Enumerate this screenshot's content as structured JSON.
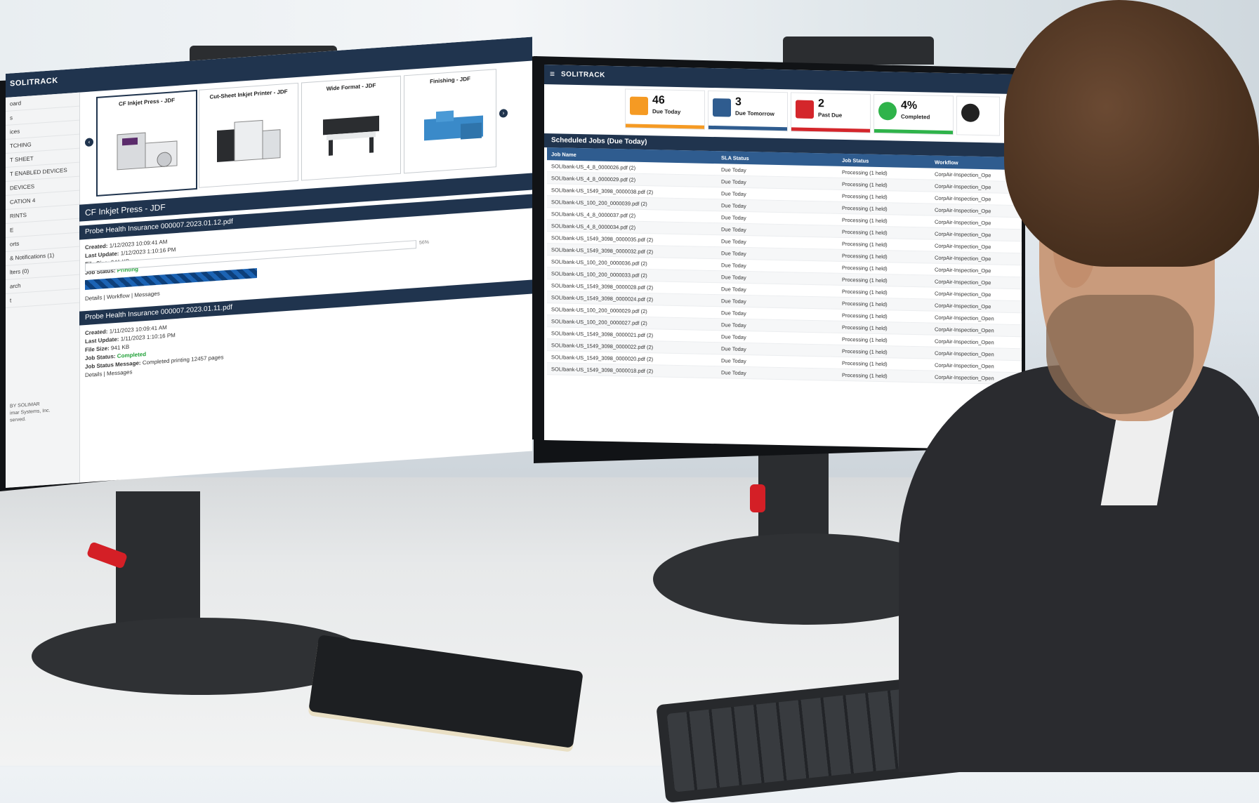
{
  "left_app": {
    "logo": "SOLITRACK",
    "sidebar": [
      "oard",
      "s",
      "ices",
      "TCHING",
      "T SHEET",
      "T ENABLED DEVICES",
      "DEVICES",
      "CATION 4",
      "RINTS",
      "E",
      "orts",
      "& Notifications (1)",
      "lters (0)",
      "arch",
      "t"
    ],
    "sidebar_footer": [
      "BY SOLIMAR",
      "imar Systems, Inc.",
      "served."
    ],
    "carousel": {
      "cards": [
        {
          "title": "CF Inkjet Press - JDF"
        },
        {
          "title": "Cut-Sheet Inkjet Printer - JDF"
        },
        {
          "title": "Wide Format - JDF"
        },
        {
          "title": "Finishing - JDF"
        }
      ]
    },
    "device_section_title": "CF Inkjet Press - JDF",
    "jobs": [
      {
        "title": "Probe Health Insurance 000007.2023.01.12.pdf",
        "created_label": "Created:",
        "created": "1/12/2023 10:09:41 AM",
        "updated_label": "Last Update:",
        "updated": "1/12/2023 1:10:16 PM",
        "size_label": "File Size:",
        "size": "941 KB",
        "status_label": "Job Status:",
        "status": "Printing",
        "progress_pct_text": "56%",
        "progress": 0.56,
        "links": "Details | Workflow | Messages"
      },
      {
        "title": "Probe Health Insurance 000007.2023.01.11.pdf",
        "created_label": "Created:",
        "created": "1/11/2023 10:09:41 AM",
        "updated_label": "Last Update:",
        "updated": "1/11/2023 1:10:16 PM",
        "size_label": "File Size:",
        "size": "941 KB",
        "status_label": "Job Status:",
        "status": "Completed",
        "messages_label": "Job Status Message:",
        "messages": "Completed printing 12457 pages",
        "links": "Details | Messages"
      }
    ]
  },
  "right_app": {
    "logo": "SOLITRACK",
    "tiles": [
      {
        "value": "46",
        "label": "Due Today",
        "color": "#f59a23"
      },
      {
        "value": "3",
        "label": "Due Tomorrow",
        "color": "#2f5c8f"
      },
      {
        "value": "2",
        "label": "Past Due",
        "color": "#d4262b"
      },
      {
        "value": "4%",
        "label": "Completed",
        "color": "#2fb34a"
      }
    ],
    "scheduled_title": "Scheduled Jobs (Due Today)",
    "table_headers": [
      "Job Name",
      "SLA Status",
      "Job Status",
      "Workflow"
    ],
    "rows": [
      [
        "SOLIbank-US_4_8_0000026.pdf (2)",
        "Due Today",
        "Processing (1 held)",
        "CorpAir-Inspection_Ope"
      ],
      [
        "SOLIbank-US_4_8_0000029.pdf (2)",
        "Due Today",
        "Processing (1 held)",
        "CorpAir-Inspection_Ope"
      ],
      [
        "SOLIbank-US_1549_3098_0000038.pdf (2)",
        "Due Today",
        "Processing (1 held)",
        "CorpAir-Inspection_Ope"
      ],
      [
        "SOLIbank-US_100_200_0000039.pdf (2)",
        "Due Today",
        "Processing (1 held)",
        "CorpAir-Inspection_Ope"
      ],
      [
        "SOLIbank-US_4_8_0000037.pdf (2)",
        "Due Today",
        "Processing (1 held)",
        "CorpAir-Inspection_Ope"
      ],
      [
        "SOLIbank-US_4_8_0000034.pdf (2)",
        "Due Today",
        "Processing (1 held)",
        "CorpAir-Inspection_Ope"
      ],
      [
        "SOLIbank-US_1549_3098_0000035.pdf (2)",
        "Due Today",
        "Processing (1 held)",
        "CorpAir-Inspection_Ope"
      ],
      [
        "SOLIbank-US_1549_3098_0000032.pdf (2)",
        "Due Today",
        "Processing (1 held)",
        "CorpAir-Inspection_Ope"
      ],
      [
        "SOLIbank-US_100_200_0000036.pdf (2)",
        "Due Today",
        "Processing (1 held)",
        "CorpAir-Inspection_Ope"
      ],
      [
        "SOLIbank-US_100_200_0000033.pdf (2)",
        "Due Today",
        "Processing (1 held)",
        "CorpAir-Inspection_Ope"
      ],
      [
        "SOLIbank-US_1549_3098_0000028.pdf (2)",
        "Due Today",
        "Processing (1 held)",
        "CorpAir-Inspection_Ope"
      ],
      [
        "SOLIbank-US_1549_3098_0000024.pdf (2)",
        "Due Today",
        "Processing (1 held)",
        "CorpAir-Inspection_Ope"
      ],
      [
        "SOLIbank-US_100_200_0000029.pdf (2)",
        "Due Today",
        "Processing (1 held)",
        "CorpAir-Inspection_Open"
      ],
      [
        "SOLIbank-US_100_200_0000027.pdf (2)",
        "Due Today",
        "Processing (1 held)",
        "CorpAir-Inspection_Open"
      ],
      [
        "SOLIbank-US_1549_3098_0000021.pdf (2)",
        "Due Today",
        "Processing (1 held)",
        "CorpAir-Inspection_Open"
      ],
      [
        "SOLIbank-US_1549_3098_0000022.pdf (2)",
        "Due Today",
        "Processing (1 held)",
        "CorpAir-Inspection_Open"
      ],
      [
        "SOLIbank-US_1549_3098_0000020.pdf (2)",
        "Due Today",
        "Processing (1 held)",
        "CorpAir-Inspection_Open"
      ],
      [
        "SOLIbank-US_1549_3098_0000018.pdf (2)",
        "Due Today",
        "Processing (1 held)",
        "CorpAir-Inspection_Open"
      ]
    ]
  }
}
